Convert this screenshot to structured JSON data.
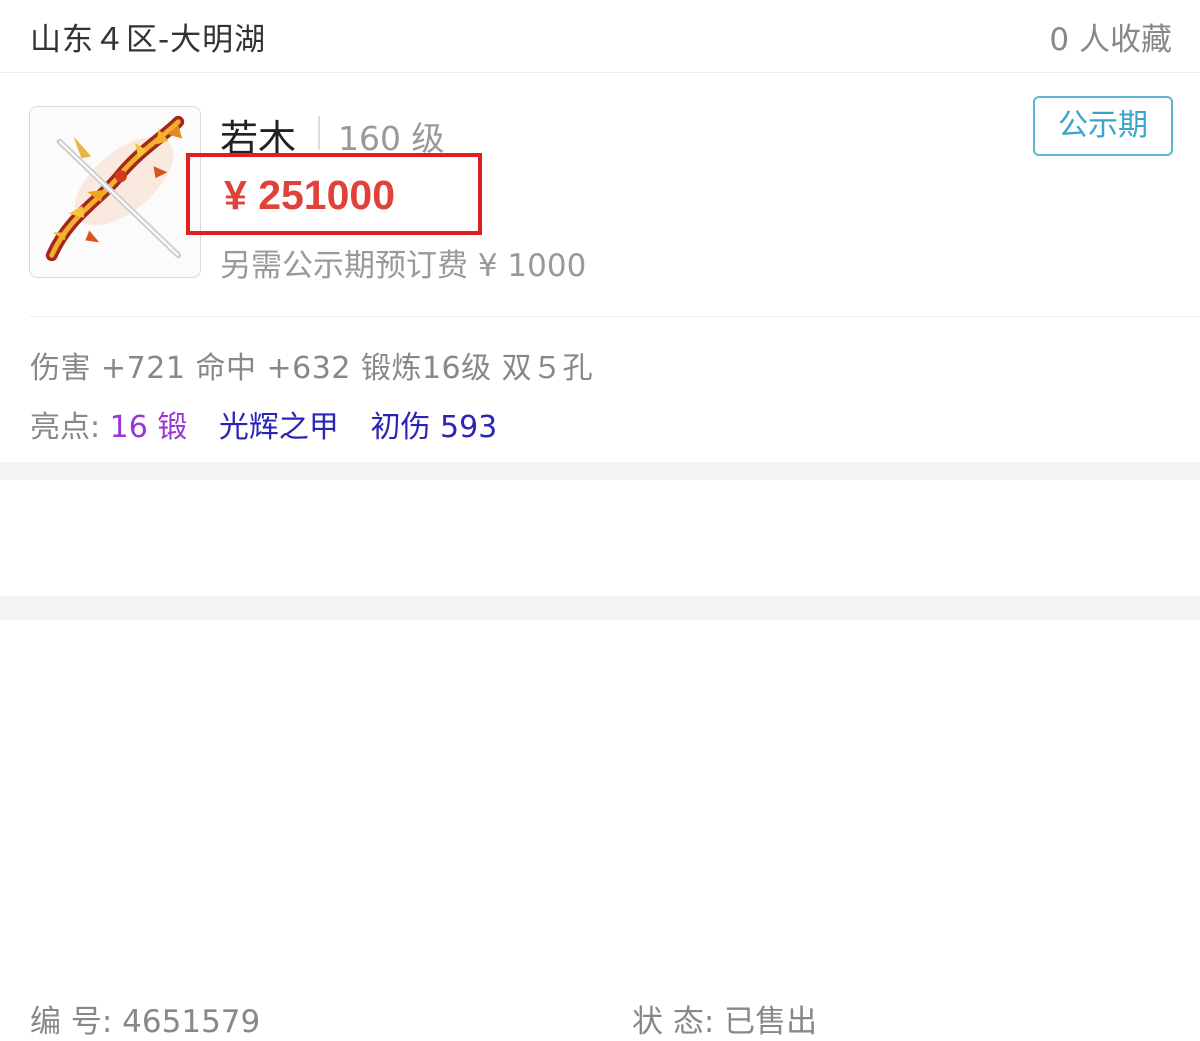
{
  "header": {
    "server": "山东４区-大明湖",
    "favorites": "0 人收藏"
  },
  "item": {
    "icon": "bow-weapon-icon",
    "name": "若木",
    "level": "160 级",
    "badge": "公示期",
    "price": "¥ 251000",
    "extra_fee": "另需公示期预订费 ¥ 1000",
    "stats": "伤害 +721 命中 +632 锻炼16级 双５孔",
    "highlights": {
      "label": "亮点: ",
      "items": [
        "16 锻",
        "光辉之甲",
        "初伤 593"
      ]
    }
  },
  "details": {
    "serial_label": "编 号:",
    "serial_value": "4651579",
    "status_label": "状 态:",
    "status_value": "已售出"
  },
  "colors": {
    "price": "#e0423a",
    "highlight_box": "#e02020",
    "badge": "#3aa5c9",
    "highlight_purple": "#9b36d6",
    "highlight_blue": "#2a25b4"
  }
}
